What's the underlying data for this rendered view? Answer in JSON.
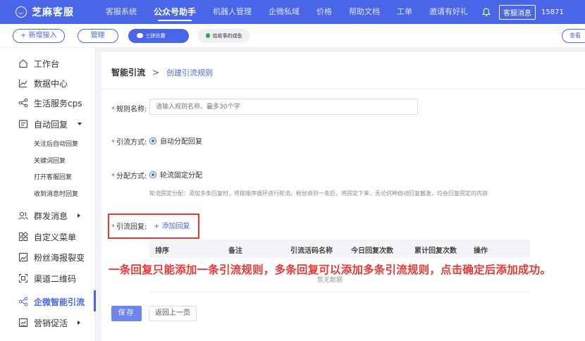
{
  "app": {
    "title": "芝麻客服",
    "nav": [
      "客服系统",
      "公众号助手",
      "机器人管理",
      "企微私域",
      "价格",
      "帮助文档",
      "工单",
      "邀请有好礼"
    ],
    "nav_active_index": 1,
    "kefu_msg": "客服消息",
    "phone": "15871"
  },
  "subbar": {
    "add_label": "+ 新增接入",
    "manage_label": "管理",
    "accounts": [
      "三拼优惠",
      "拾故事的咸鱼"
    ],
    "view_label": "查看"
  },
  "sidebar": {
    "items": [
      "工作台",
      "数据中心",
      "生活服务cps",
      "自动回复",
      "群发消息",
      "自定义菜单",
      "粉丝海报裂变",
      "渠道二维码",
      "企微智能引流",
      "营销促活"
    ],
    "sub_items": [
      "关注后自动回复",
      "关键词回复",
      "打开客服回复",
      "收到消息时回复"
    ],
    "active": "企微智能引流"
  },
  "breadcrumb": {
    "parent": "智能引流",
    "separator": ">",
    "current": "创建引流规则"
  },
  "form": {
    "rule_name_label": "规则名称:",
    "rule_name_placeholder": "请输入规则名称、最多30个字",
    "method_label": "引流方式:",
    "method_value": "自动分配回复",
    "distribution_label": "分配方式:",
    "distribution_value": "轮流固定分配",
    "distribution_hint": "轮流固定分配：添加多条回复时，将按顺序循环进行轮流，粉丝收到一条后，将固定下来，无论何种自动回复触发，均会回复固定的内容",
    "reply_label": "引流回复:",
    "add_reply": "+ 添加回复",
    "required_mark": "*"
  },
  "table": {
    "columns": [
      "排序",
      "备注",
      "引流活码名称",
      "今日回复次数",
      "累计回复次数",
      "操作"
    ],
    "empty_text": "暂无数据"
  },
  "annotation": "一条回复只能添加一条引流规则，多条回复可以添加多条引流规则，点击确定后添加成功。",
  "actions": {
    "save": "保存",
    "back": "返回上一页"
  },
  "colors": {
    "primary": "#4a66e8",
    "annotation_red": "#e53935"
  }
}
